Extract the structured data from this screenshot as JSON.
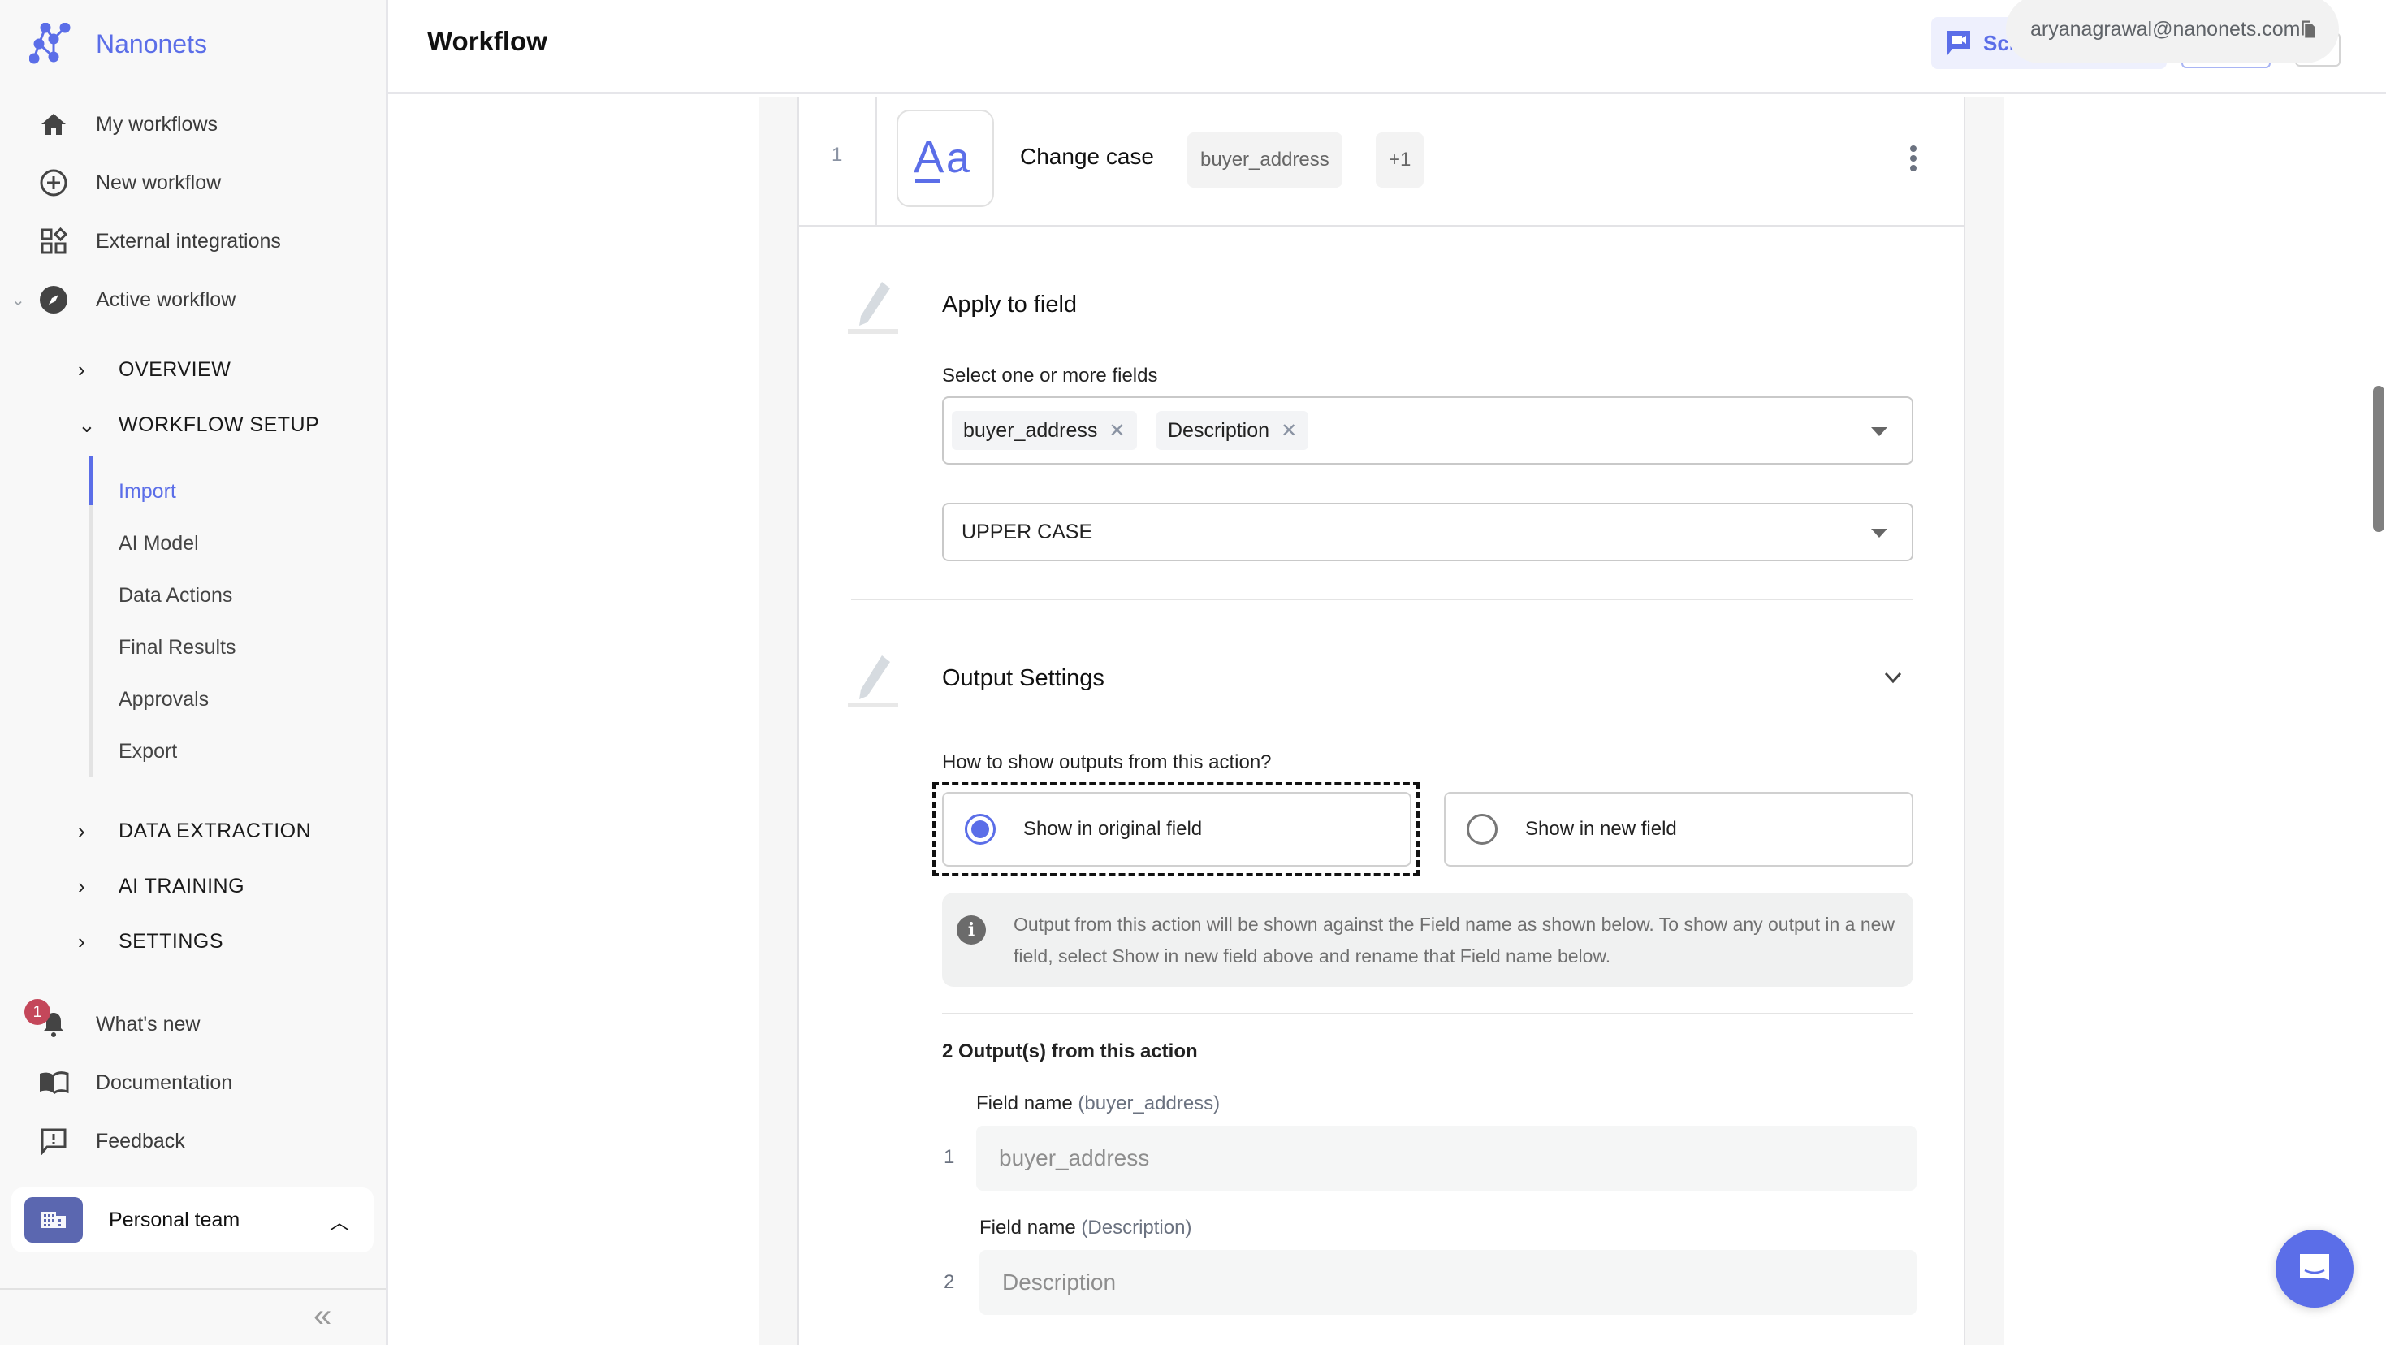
{
  "app": {
    "brand": "Nanonets",
    "brand_color": "#5b6ee8"
  },
  "sidebar": {
    "main_items": [
      {
        "label": "My workflows",
        "icon": "home-icon"
      },
      {
        "label": "New workflow",
        "icon": "add-circle-icon"
      },
      {
        "label": "External integrations",
        "icon": "widgets-icon"
      },
      {
        "label": "Active workflow",
        "icon": "compass-icon"
      }
    ],
    "sections": [
      {
        "label": "OVERVIEW",
        "expanded": false
      },
      {
        "label": "WORKFLOW SETUP",
        "expanded": true
      },
      {
        "label": "DATA EXTRACTION",
        "expanded": false
      },
      {
        "label": "AI TRAINING",
        "expanded": false
      },
      {
        "label": "SETTINGS",
        "expanded": false
      }
    ],
    "workflow_setup_items": [
      {
        "label": "Import",
        "active": true
      },
      {
        "label": "AI Model",
        "active": false
      },
      {
        "label": "Data Actions",
        "active": false
      },
      {
        "label": "Final Results",
        "active": false
      },
      {
        "label": "Approvals",
        "active": false
      },
      {
        "label": "Export",
        "active": false
      }
    ],
    "footer_items": [
      {
        "label": "What's new",
        "icon": "bell-icon",
        "badge": "1"
      },
      {
        "label": "Documentation",
        "icon": "book-icon"
      },
      {
        "label": "Feedback",
        "icon": "feedback-icon"
      }
    ],
    "team": {
      "label": "Personal team"
    },
    "collapse_glyph": "«"
  },
  "header": {
    "title": "Workflow",
    "schedule_button_label": "Sch",
    "user_email": "aryanagrawal@nanonets.com"
  },
  "action_card": {
    "step_number": "1",
    "icon_text": "Aa",
    "title": "Change case",
    "field_chip": "buyer_address",
    "more_chip": "+1",
    "apply_section": {
      "title": "Apply to field",
      "select_label": "Select one or more fields",
      "selected_fields": [
        "buyer_address",
        "Description"
      ],
      "case_value": "UPPER CASE"
    },
    "output_section": {
      "title": "Output Settings",
      "question": "How to show outputs from this action?",
      "options": [
        {
          "label": "Show in original field",
          "selected": true
        },
        {
          "label": "Show in new field",
          "selected": false
        }
      ],
      "info_text": "Output from this action will be shown against the Field name as shown below. To show any output in a new field, select Show in new field above and rename that Field name below.",
      "outputs_title": "2 Output(s) from this action",
      "outputs": [
        {
          "index": "1",
          "label": "Field name",
          "field": "(buyer_address)",
          "placeholder": "buyer_address"
        },
        {
          "index": "2",
          "label": "Field name",
          "field": "(Description)",
          "placeholder": "Description"
        }
      ]
    }
  }
}
